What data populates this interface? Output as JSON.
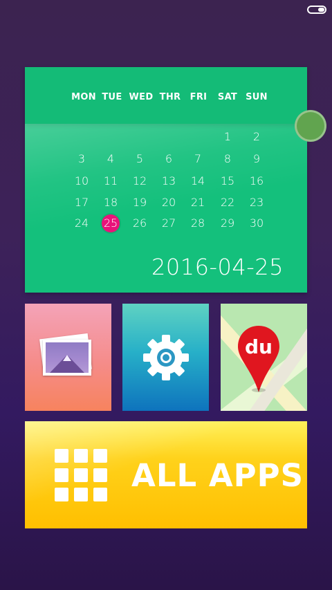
{
  "status_bar": {
    "battery_icon": "battery-icon"
  },
  "calendar": {
    "weekdays": [
      "MON",
      "TUE",
      "WED",
      "THR",
      "FRI",
      "SAT",
      "SUN"
    ],
    "rows": [
      [
        "",
        "",
        "",
        "",
        "",
        "1",
        "2"
      ],
      [
        "3",
        "4",
        "5",
        "6",
        "7",
        "8",
        "9"
      ],
      [
        "10",
        "11",
        "12",
        "13",
        "14",
        "15",
        "16"
      ],
      [
        "17",
        "18",
        "19",
        "20",
        "21",
        "22",
        "23"
      ],
      [
        "24",
        "25",
        "26",
        "27",
        "28",
        "29",
        "30"
      ]
    ],
    "today": "25",
    "date_text": "2016-04-25",
    "colors": {
      "header": "#14bb77",
      "body": "#14c07c",
      "today": "#e8137a"
    }
  },
  "tiles": [
    {
      "id": "gallery",
      "icon": "photos-icon"
    },
    {
      "id": "settings",
      "icon": "gear-icon"
    },
    {
      "id": "maps",
      "icon": "map-pin-icon",
      "pin_text": "du"
    }
  ],
  "all_apps": {
    "label": "ALL APPS",
    "icon": "app-grid-icon",
    "color": "#ffc400"
  }
}
